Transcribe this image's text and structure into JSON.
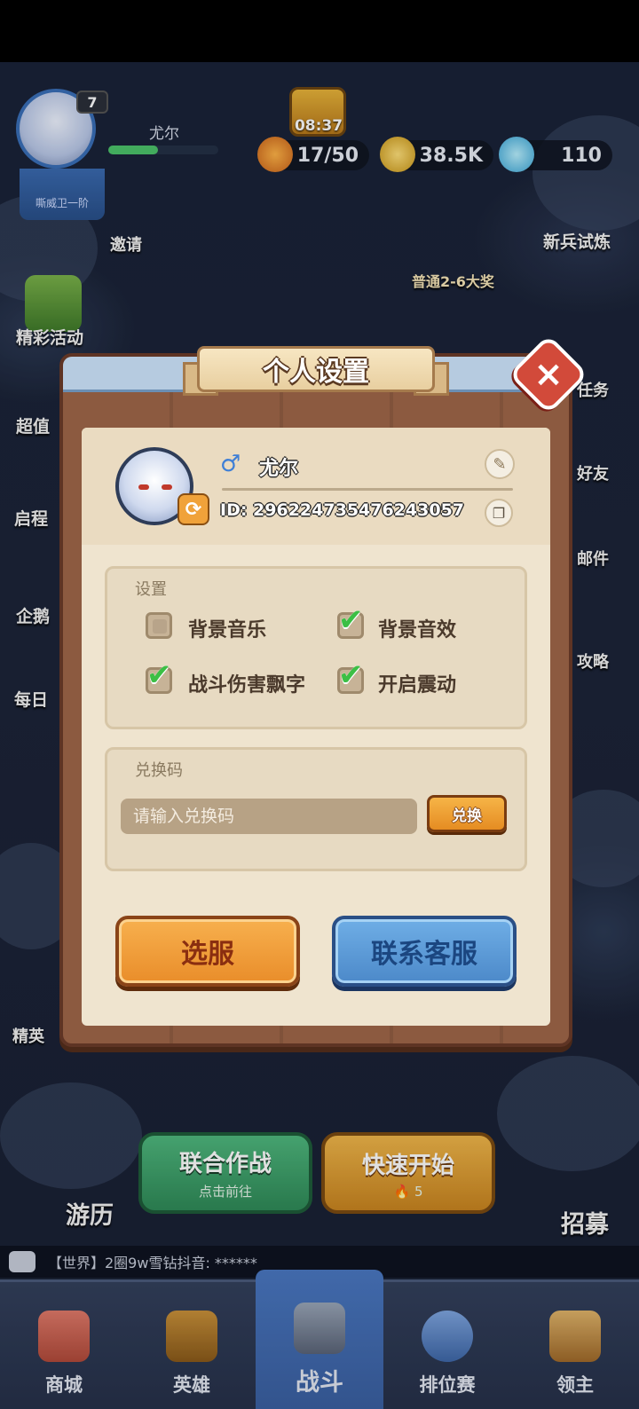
{
  "hud": {
    "level": "7",
    "player_name": "尤尔",
    "xp_fraction": 0.45,
    "rank_title": "嘶威卫一阶",
    "timer": "08:37",
    "stamina": "17/50",
    "gold": "38.5K",
    "gems": "110",
    "invite_label": "邀请",
    "reward_label": "普通2-6大奖",
    "left_menu": [
      "精彩活动",
      "超值",
      "启程",
      "企鹅",
      "每日"
    ],
    "right_menu": [
      "新兵试炼",
      "任务",
      "好友",
      "邮件",
      "攻略"
    ],
    "elite_label": "精英"
  },
  "lobby": {
    "coop_title": "联合作战",
    "coop_sub": "点击前往",
    "quick_start": "快速开始",
    "quick_cost": "5",
    "travel_label": "游历",
    "recruit_label": "招募",
    "chat_message": "【世界】2圈9w雪钻抖音: ******"
  },
  "nav": {
    "items": [
      {
        "label": "商城"
      },
      {
        "label": "英雄"
      },
      {
        "label": "战斗"
      },
      {
        "label": "排位赛"
      },
      {
        "label": "领主"
      }
    ]
  },
  "modal": {
    "title": "个人设置",
    "close_glyph": "×",
    "profile": {
      "gender_glyph": "♂",
      "name": "尤尔",
      "id_text": "ID: 296224735476243057"
    },
    "settings": {
      "section_title": "设置",
      "options": [
        {
          "label": "背景音乐",
          "checked": false
        },
        {
          "label": "背景音效",
          "checked": true
        },
        {
          "label": "战斗伤害飘字",
          "checked": true
        },
        {
          "label": "开启震动",
          "checked": true
        }
      ]
    },
    "redeem": {
      "section_title": "兑换码",
      "placeholder": "请输入兑换码",
      "button_label": "兑换"
    },
    "select_server_label": "选服",
    "contact_support_label": "联系客服"
  },
  "colors": {
    "frame_wood": "#8c5a40",
    "panel_bg": "#efe4cf",
    "check_green": "#3cbf45",
    "orange_button": "#e98d2a",
    "blue_button": "#4c89c9"
  }
}
